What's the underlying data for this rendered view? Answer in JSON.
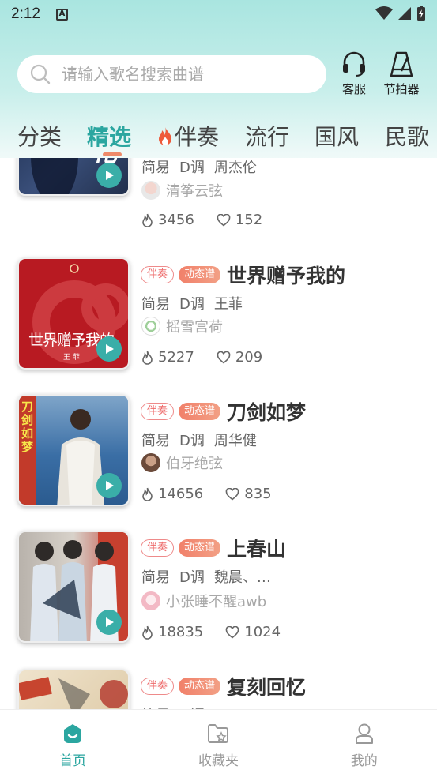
{
  "status_bar": {
    "time": "2:12",
    "notif_letter": "A"
  },
  "search": {
    "placeholder": "请输入歌名搜索曲谱",
    "value": ""
  },
  "top_actions": {
    "service_label": "客服",
    "metronome_label": "节拍器"
  },
  "tabs": [
    {
      "label": "分类",
      "active": false,
      "hot": false
    },
    {
      "label": "精选",
      "active": true,
      "hot": false
    },
    {
      "label": "伴奏",
      "active": false,
      "hot": true
    },
    {
      "label": "流行",
      "active": false,
      "hot": false
    },
    {
      "label": "国风",
      "active": false,
      "hot": false
    },
    {
      "label": "民歌",
      "active": false,
      "hot": false
    }
  ],
  "colors": {
    "accent": "#2ba6a0",
    "tab_underline": "#ee8a6a",
    "play": "#3aaea8",
    "badge_outline": "#ee6b6b",
    "badge_fill": "#f1806a"
  },
  "songs": [
    {
      "title": "",
      "badge_accompaniment": "",
      "badge_dynamic": "",
      "difficulty": "简易",
      "key": "D调",
      "artist": "周杰伦",
      "author": "清筝云弦",
      "plays": "3456",
      "likes": "152",
      "cover_text": "花",
      "cover_theme": "dark-blue"
    },
    {
      "title": "世界赠予我的",
      "badge_accompaniment": "伴奏",
      "badge_dynamic": "动态谱",
      "difficulty": "简易",
      "key": "D调",
      "artist": "王菲",
      "author": "摇雪宫荷",
      "plays": "5227",
      "likes": "209",
      "cover_text": "世界赠予我的",
      "cover_sub": "王 菲",
      "cover_theme": "red"
    },
    {
      "title": "刀剑如梦",
      "badge_accompaniment": "伴奏",
      "badge_dynamic": "动态谱",
      "difficulty": "简易",
      "key": "D调",
      "artist": "周华健",
      "author": "伯牙绝弦",
      "plays": "14656",
      "likes": "835",
      "cover_text": "刀剑如梦",
      "cover_theme": "blue"
    },
    {
      "title": "上春山",
      "badge_accompaniment": "伴奏",
      "badge_dynamic": "动态谱",
      "difficulty": "简易",
      "key": "D调",
      "artist": "魏晨、…",
      "author": "小张睡不醒awb",
      "plays": "18835",
      "likes": "1024",
      "cover_text": "",
      "cover_theme": "red-fans"
    },
    {
      "title": "复刻回忆",
      "badge_accompaniment": "伴奏",
      "badge_dynamic": "动态谱",
      "difficulty": "简易",
      "key": "D调",
      "artist": "",
      "author": "",
      "plays": "",
      "likes": "",
      "cover_text": "",
      "cover_theme": "vintage"
    }
  ],
  "bottom_nav": [
    {
      "label": "首页",
      "active": true,
      "icon": "home-icon"
    },
    {
      "label": "收藏夹",
      "active": false,
      "icon": "favorites-folder-icon"
    },
    {
      "label": "我的",
      "active": false,
      "icon": "profile-icon"
    }
  ]
}
